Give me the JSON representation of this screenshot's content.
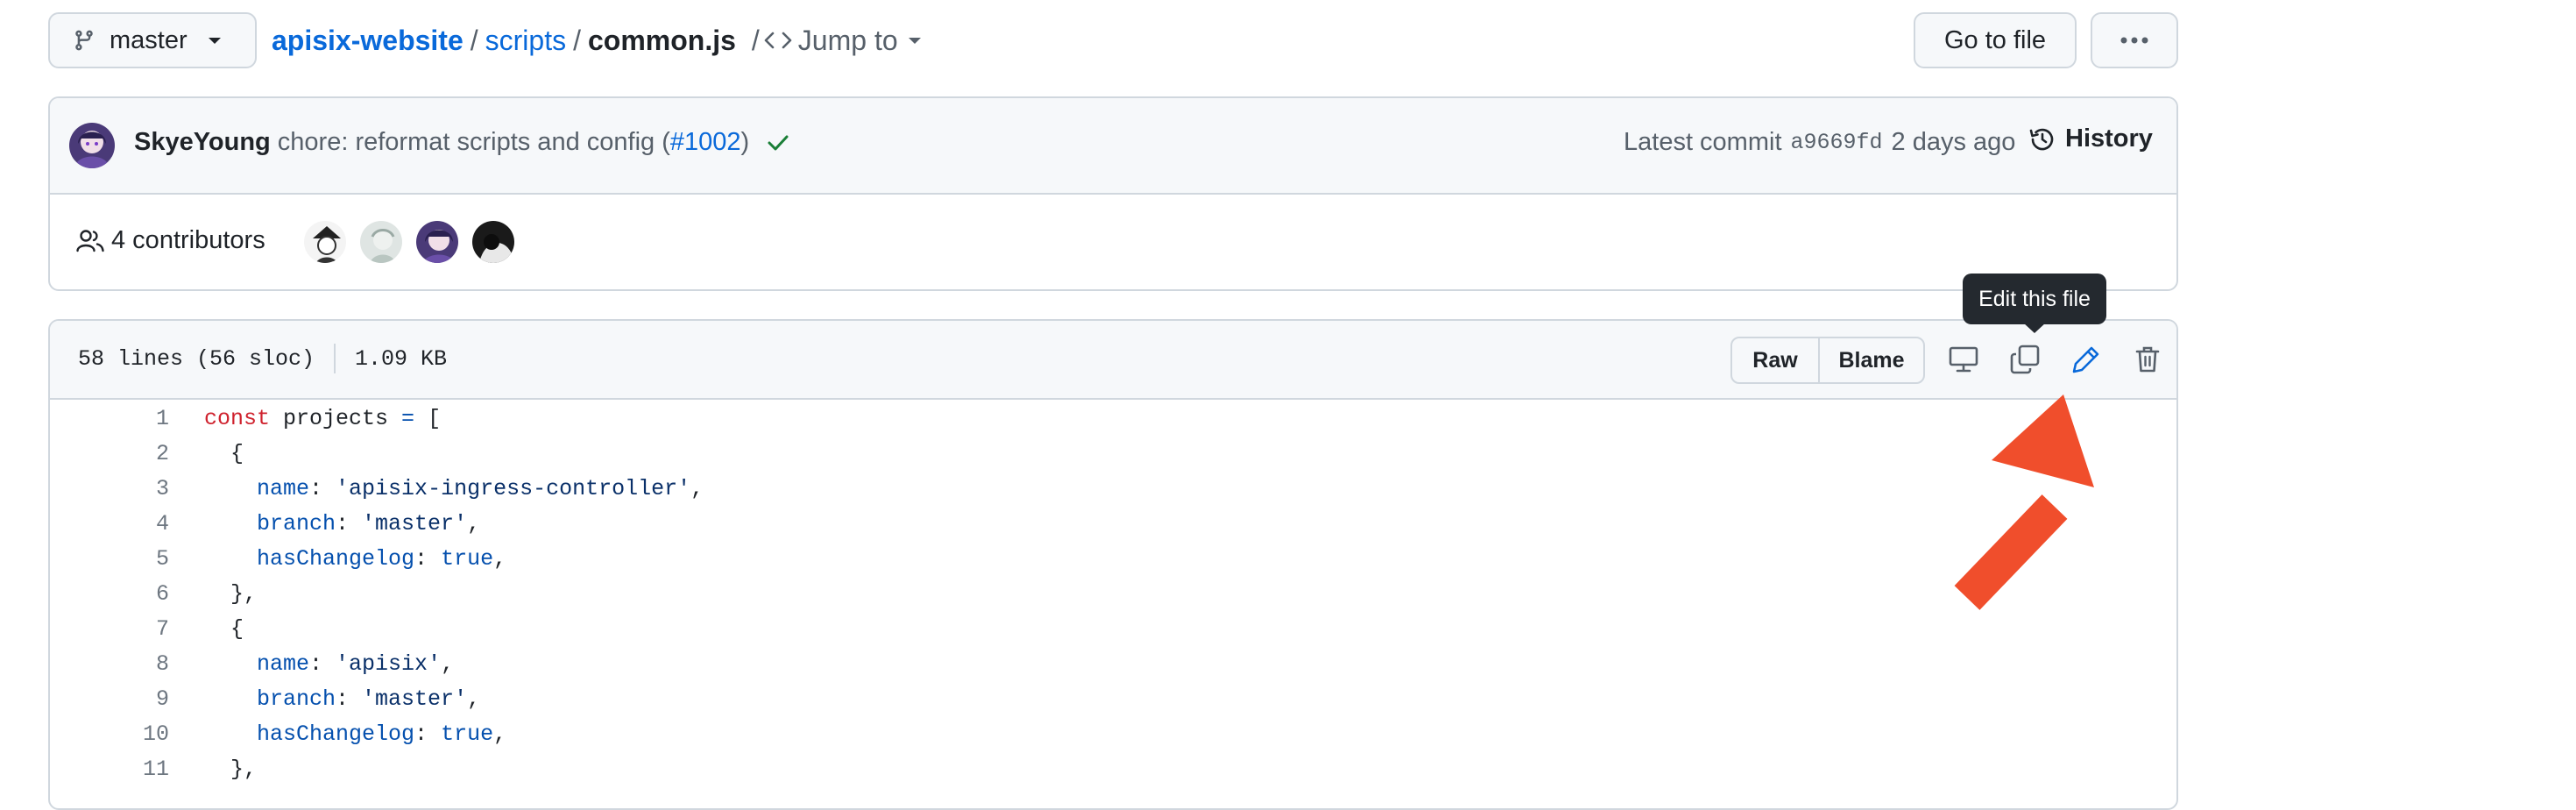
{
  "branch": {
    "name": "master"
  },
  "breadcrumb": {
    "repo": "apisix-website",
    "sep1": "/",
    "folder": "scripts",
    "sep2": "/",
    "file": "common.js",
    "sep3": "/",
    "jump_to": "Jump to"
  },
  "header_actions": {
    "go_to_file": "Go to file",
    "more": "···"
  },
  "commit": {
    "author": "SkyeYoung",
    "message_prefix": "chore: reformat scripts and config (",
    "pr": "#1002",
    "message_suffix": ")",
    "latest_label": "Latest commit",
    "sha": "a9669fd",
    "time": "2 days ago",
    "history": "History"
  },
  "contributors": {
    "label": "4 contributors"
  },
  "file_info": {
    "lines": "58 lines (56 sloc)",
    "size": "1.09 KB"
  },
  "file_actions": {
    "raw": "Raw",
    "blame": "Blame",
    "tooltip": "Edit this file"
  },
  "colors": {
    "accent": "#0969da",
    "arrow": "#f04e2c",
    "check": "#1a7f37",
    "tooltip_bg": "#24292f"
  },
  "code": [
    {
      "n": "1",
      "tokens": [
        {
          "c": "kw",
          "t": "const"
        },
        {
          "c": "",
          "t": " projects "
        },
        {
          "c": "op",
          "t": "="
        },
        {
          "c": "",
          "t": " ["
        }
      ]
    },
    {
      "n": "2",
      "tokens": [
        {
          "c": "",
          "t": "  {"
        }
      ]
    },
    {
      "n": "3",
      "tokens": [
        {
          "c": "",
          "t": "    "
        },
        {
          "c": "prop",
          "t": "name"
        },
        {
          "c": "",
          "t": ": "
        },
        {
          "c": "str",
          "t": "'apisix-ingress-controller'"
        },
        {
          "c": "",
          "t": ","
        }
      ]
    },
    {
      "n": "4",
      "tokens": [
        {
          "c": "",
          "t": "    "
        },
        {
          "c": "prop",
          "t": "branch"
        },
        {
          "c": "",
          "t": ": "
        },
        {
          "c": "str",
          "t": "'master'"
        },
        {
          "c": "",
          "t": ","
        }
      ]
    },
    {
      "n": "5",
      "tokens": [
        {
          "c": "",
          "t": "    "
        },
        {
          "c": "prop",
          "t": "hasChangelog"
        },
        {
          "c": "",
          "t": ": "
        },
        {
          "c": "bool",
          "t": "true"
        },
        {
          "c": "",
          "t": ","
        }
      ]
    },
    {
      "n": "6",
      "tokens": [
        {
          "c": "",
          "t": "  },"
        }
      ]
    },
    {
      "n": "7",
      "tokens": [
        {
          "c": "",
          "t": "  {"
        }
      ]
    },
    {
      "n": "8",
      "tokens": [
        {
          "c": "",
          "t": "    "
        },
        {
          "c": "prop",
          "t": "name"
        },
        {
          "c": "",
          "t": ": "
        },
        {
          "c": "str",
          "t": "'apisix'"
        },
        {
          "c": "",
          "t": ","
        }
      ]
    },
    {
      "n": "9",
      "tokens": [
        {
          "c": "",
          "t": "    "
        },
        {
          "c": "prop",
          "t": "branch"
        },
        {
          "c": "",
          "t": ": "
        },
        {
          "c": "str",
          "t": "'master'"
        },
        {
          "c": "",
          "t": ","
        }
      ]
    },
    {
      "n": "10",
      "tokens": [
        {
          "c": "",
          "t": "    "
        },
        {
          "c": "prop",
          "t": "hasChangelog"
        },
        {
          "c": "",
          "t": ": "
        },
        {
          "c": "bool",
          "t": "true"
        },
        {
          "c": "",
          "t": ","
        }
      ]
    },
    {
      "n": "11",
      "tokens": [
        {
          "c": "",
          "t": "  },"
        }
      ]
    }
  ]
}
